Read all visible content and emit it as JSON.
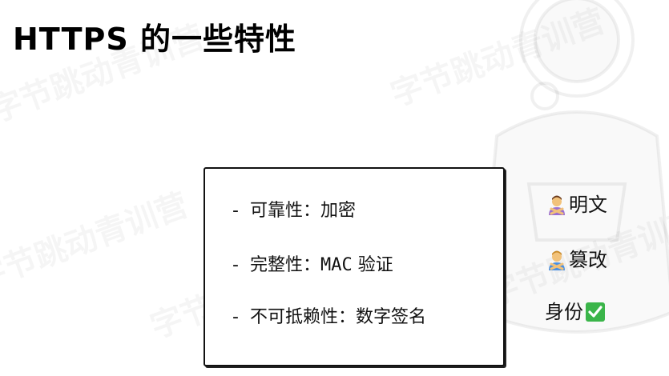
{
  "title": "HTTPS 的一些特性",
  "watermark": "字节跳动青训营",
  "box_items": [
    {
      "dash": "-",
      "text": "可靠性：加密"
    },
    {
      "dash": "-",
      "text_pre": "完整性：",
      "text_mono": "MAC",
      "text_post": " 验证"
    },
    {
      "dash": "-",
      "text": "不可抵赖性：数字签名"
    }
  ],
  "side_labels": [
    {
      "icon": "person-gesturing-no-icon",
      "text": "明文"
    },
    {
      "icon": "person-gesturing-no-icon",
      "text": "篡改"
    },
    {
      "icon": "check-mark-button-icon",
      "text": "身份"
    }
  ],
  "colors": {
    "check_green": "#3bb54a",
    "person_orange": "#f2a33a",
    "person_purple": "#9b6fd1",
    "person_blue": "#4a90e2"
  }
}
